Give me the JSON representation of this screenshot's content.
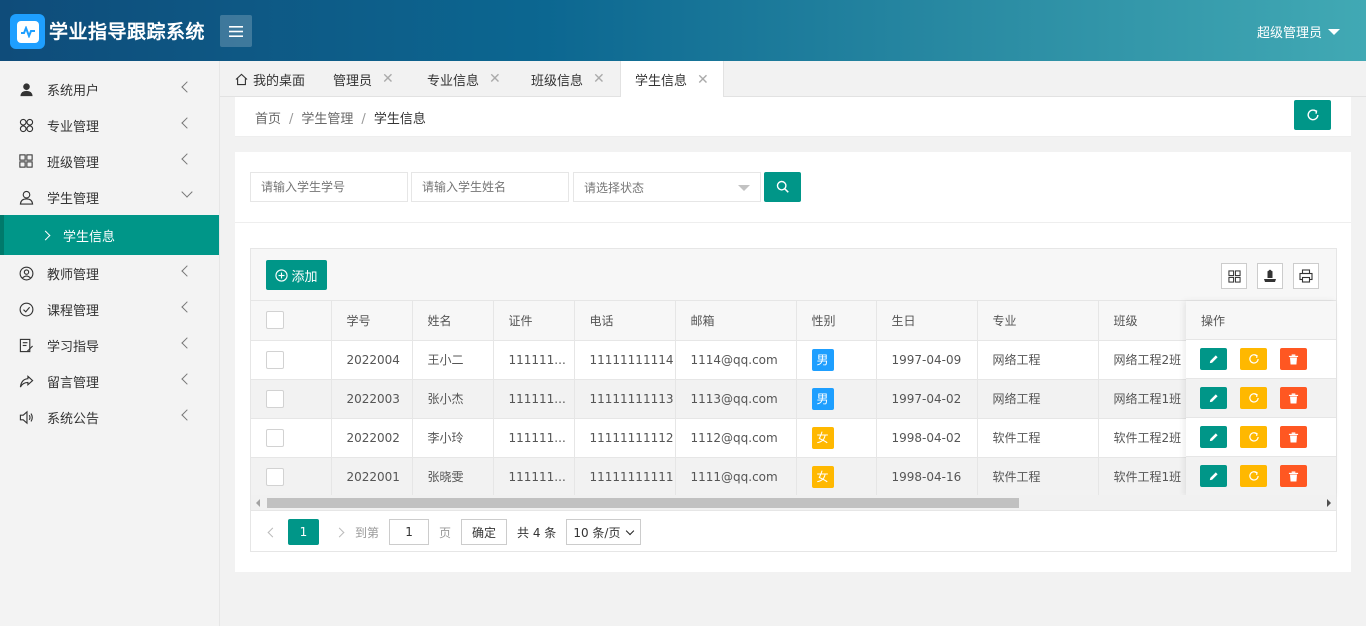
{
  "app": {
    "title": "学业指导跟踪系统",
    "user": "超级管理员"
  },
  "sidebar": {
    "items": [
      {
        "label": "系统用户",
        "icon": "user-icon"
      },
      {
        "label": "专业管理",
        "icon": "clover-icon"
      },
      {
        "label": "班级管理",
        "icon": "grid-icon"
      },
      {
        "label": "学生管理",
        "icon": "person-outline-icon",
        "expanded": true
      },
      {
        "label": "教师管理",
        "icon": "face-icon"
      },
      {
        "label": "课程管理",
        "icon": "check-circle-icon"
      },
      {
        "label": "学习指导",
        "icon": "edit-doc-icon"
      },
      {
        "label": "留言管理",
        "icon": "share-icon"
      },
      {
        "label": "系统公告",
        "icon": "speaker-icon"
      }
    ],
    "sub_active": "学生信息"
  },
  "tabs": [
    {
      "label": "我的桌面"
    },
    {
      "label": "管理员"
    },
    {
      "label": "专业信息"
    },
    {
      "label": "班级信息"
    },
    {
      "label": "学生信息",
      "active": true
    }
  ],
  "breadcrumb": {
    "home": "首页",
    "section": "学生管理",
    "current": "学生信息"
  },
  "search": {
    "student_no_placeholder": "请输入学生学号",
    "student_name_placeholder": "请输入学生姓名",
    "status_placeholder": "请选择状态"
  },
  "toolbar": {
    "add_label": "添加"
  },
  "table": {
    "headers": [
      "学号",
      "姓名",
      "证件",
      "电话",
      "邮箱",
      "性别",
      "生日",
      "专业",
      "班级",
      "操作"
    ],
    "rows": [
      {
        "no": "2022004",
        "name": "王小二",
        "id": "111111...",
        "phone": "11111111114",
        "email": "1114@qq.com",
        "gender": "男",
        "birthday": "1997-04-09",
        "major": "网络工程",
        "class": "网络工程2班"
      },
      {
        "no": "2022003",
        "name": "张小杰",
        "id": "111111...",
        "phone": "11111111113",
        "email": "1113@qq.com",
        "gender": "男",
        "birthday": "1997-04-02",
        "major": "网络工程",
        "class": "网络工程1班"
      },
      {
        "no": "2022002",
        "name": "李小玲",
        "id": "111111...",
        "phone": "11111111112",
        "email": "1112@qq.com",
        "gender": "女",
        "birthday": "1998-04-02",
        "major": "软件工程",
        "class": "软件工程2班"
      },
      {
        "no": "2022001",
        "name": "张晓雯",
        "id": "111111...",
        "phone": "11111111111",
        "email": "1111@qq.com",
        "gender": "女",
        "birthday": "1998-04-16",
        "major": "软件工程",
        "class": "软件工程1班"
      }
    ]
  },
  "pager": {
    "current": "1",
    "goto_label": "到第",
    "goto_value": "1",
    "page_label": "页",
    "confirm": "确定",
    "total": "共 4 条",
    "page_size": "10 条/页"
  },
  "colors": {
    "primary": "#009688",
    "warn": "#ffb800",
    "danger": "#ff5722",
    "male": "#1e9fff"
  }
}
